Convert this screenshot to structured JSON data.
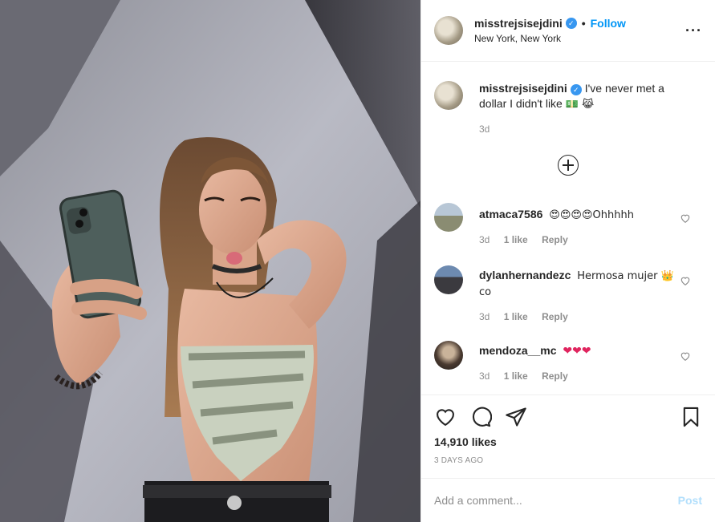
{
  "post": {
    "username": "misstrejsisejdini",
    "verified_icon": "verified-badge-icon",
    "follow_label": "Follow",
    "location": "New York, New York",
    "caption": "I've never met a dollar I didn't like",
    "caption_emoji": "💵 😹",
    "caption_age": "3d",
    "likes": "14,910 likes",
    "date": "3 DAYS AGO"
  },
  "comments": [
    {
      "username": "atmaca7586",
      "text": "😍😍😍😍Ohhhhh",
      "age": "3d",
      "likes": "1 like",
      "reply": "Reply"
    },
    {
      "username": "dylanhernandezc",
      "text": "Hermosa mujer 👑 co",
      "age": "3d",
      "likes": "1 like",
      "reply": "Reply"
    },
    {
      "username": "mendoza__mc",
      "text": "❤❤❤",
      "age": "3d",
      "likes": "1 like",
      "reply": "Reply"
    }
  ],
  "add_comment": {
    "placeholder": "Add a comment...",
    "post_label": "Post"
  },
  "icons": [
    "more-options-icon",
    "load-more-icon",
    "like-heart-icon",
    "comment-icon",
    "share-icon",
    "save-bookmark-icon",
    "comment-like-heart-icon"
  ],
  "colors": {
    "accent": "#0095f6",
    "post_disabled": "#b2dffc",
    "meta_gray": "#8e8e8e",
    "border": "#efefef"
  }
}
